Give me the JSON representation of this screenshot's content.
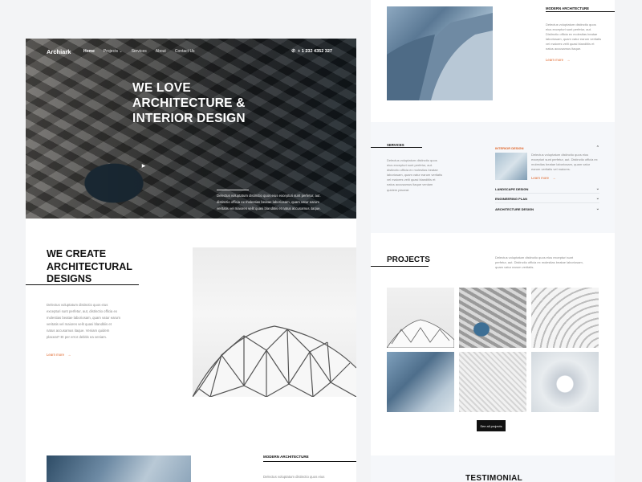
{
  "nav": {
    "logo": "Archiark",
    "links": [
      "Home",
      "Projects",
      "Services",
      "About",
      "Contact Us"
    ],
    "phone": "+ 1 232 4352 327"
  },
  "hero": {
    "title": "WE LOVE ARCHITECTURE & INTERIOR DESIGN",
    "description": "Delectus voluptatum distinctio quos eius excepturi sunt perfetur, aut. distinctio officia ex molestias beatae laboriosam, quam vatur earum veritatis vel maiores velit quasi blanditiis et natus accusamus itaque."
  },
  "create": {
    "title": "WE CREATE ARCHITECTURAL DESIGNS",
    "description": "Delectus voluptatum distinctio quos eius excepturi sunt perfetur, aut, distinctio officia ex molestias beatae laboriosam, quam vatur earum veritatis vel maiores velit quasi blanditiis et natus accusamus itaque. Veniam quidem placeat? Et per error debitis ea veniam.",
    "learn_more": "Learn more"
  },
  "modern_left": {
    "title": "MODERN ARCHITECTURE",
    "description": "Delectus voluptatum distinctio quos eius"
  },
  "modern_right": {
    "title": "MODERN ARCHITECTURE",
    "description": "Delectus voluptatum distinctio quos eius excepturi sunt perfetur, aut. Distinctio officia ex molestias beatae laboriosam, quam vatur earum veritatis vel maiores velit quasi blanditiis et natus accusamus itaque.",
    "learn_more": "Learn more"
  },
  "services": {
    "title": "SERVICES",
    "description": "Delectus voluptatum distinctio quos eius excepturi sunt perfetur, aut. distinctio officia ex molestias beatae laboriosam, quam vatur earum veritatis vel maiores velit quasi blanditiis et natus accusamus itaque veniam quidem placeat.",
    "active": {
      "label": "INTERIOR DESIGN",
      "description": "Delectus voluptatum distinctio quos eius excepturi sunt perfetur, aut. Distinctio officia ex molestias beatae laboriosam, quam vatur earum veritatis vel maiores.",
      "learn_more": "Learn more"
    },
    "items": [
      "LANDSCAPE DESIGN",
      "ENGINEERING PLAN",
      "ARCHITECTURE DESIGN"
    ]
  },
  "projects": {
    "title": "PROJECTS",
    "description": "Delectus voluptatum distinctio quos eius excepturi sunt perfetur, aut. Distinctio officia ex molestias beatae laboriosam, quam vatur earum veritatis.",
    "see_all": "See all projects"
  },
  "testimonial": {
    "title": "TESTIMONIAL"
  }
}
